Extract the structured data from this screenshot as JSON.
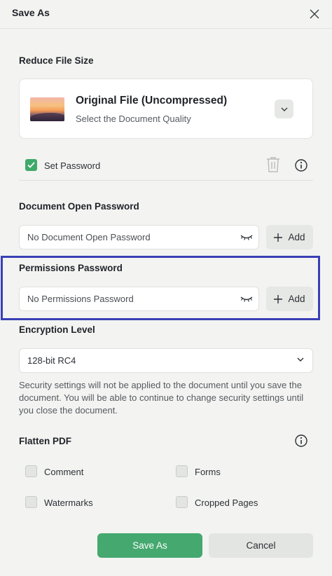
{
  "dialog": {
    "title": "Save As"
  },
  "reduce_file_size": {
    "label": "Reduce File Size",
    "option_title": "Original File (Uncompressed)",
    "option_subtitle": "Select the Document Quality"
  },
  "set_password": {
    "label": "Set Password",
    "checked": true
  },
  "open_password": {
    "label": "Document Open Password",
    "placeholder": "No Document Open Password",
    "add_label": "Add"
  },
  "permissions_password": {
    "label": "Permissions Password",
    "placeholder": "No Permissions Password",
    "add_label": "Add"
  },
  "encryption": {
    "label": "Encryption Level",
    "selected": "128-bit RC4",
    "note": "Security settings will not be applied to the document until you save the document. You will be able to continue to change security settings until you close the document."
  },
  "flatten": {
    "label": "Flatten PDF",
    "options": [
      {
        "label": "Comment",
        "checked": false
      },
      {
        "label": "Forms",
        "checked": false
      },
      {
        "label": "Watermarks",
        "checked": false
      },
      {
        "label": "Cropped Pages",
        "checked": false
      }
    ]
  },
  "footer": {
    "save_label": "Save As",
    "cancel_label": "Cancel"
  },
  "colors": {
    "primary": "#45a86f",
    "highlight": "#3a3fb5",
    "checkbox_checked": "#3daa6a"
  }
}
